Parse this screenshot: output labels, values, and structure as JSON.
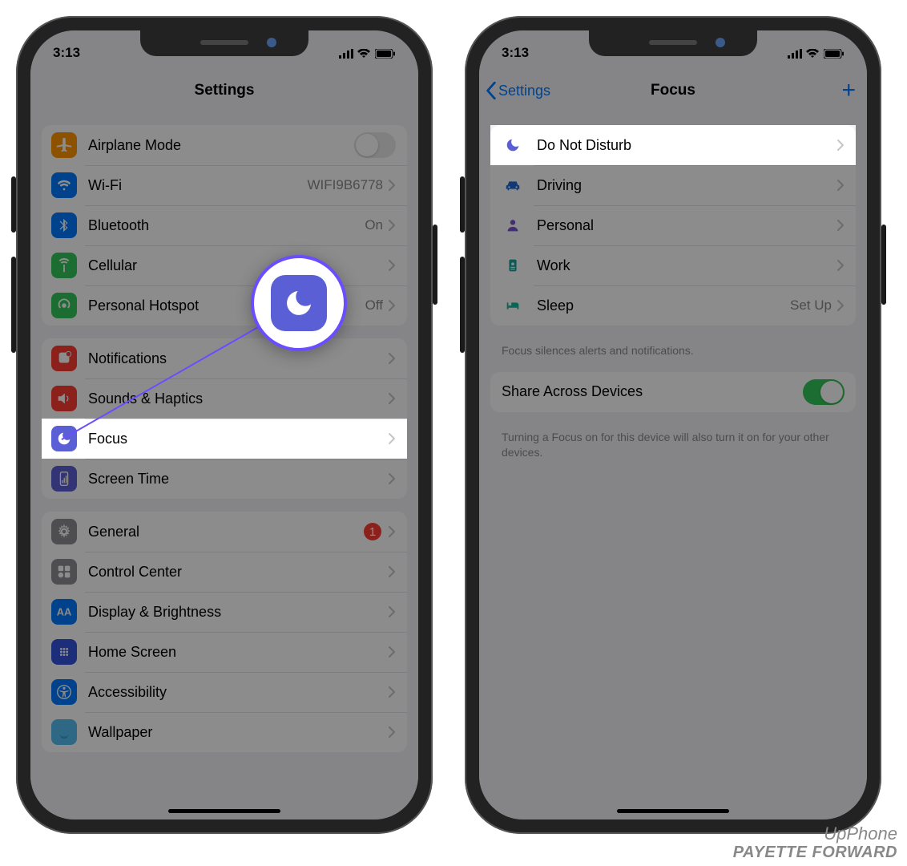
{
  "status": {
    "time": "3:13"
  },
  "left": {
    "title": "Settings",
    "groups": [
      {
        "rows": [
          {
            "icon": "airplane",
            "label": "Airplane Mode",
            "toggle": false
          },
          {
            "icon": "wifi",
            "label": "Wi-Fi",
            "detail": "WIFI9B6778"
          },
          {
            "icon": "bluetooth",
            "label": "Bluetooth",
            "detail": "On"
          },
          {
            "icon": "cellular",
            "label": "Cellular"
          },
          {
            "icon": "hotspot",
            "label": "Personal Hotspot",
            "detail": "Off"
          }
        ]
      },
      {
        "rows": [
          {
            "icon": "notifications",
            "label": "Notifications"
          },
          {
            "icon": "sounds",
            "label": "Sounds & Haptics"
          },
          {
            "icon": "focus",
            "label": "Focus",
            "highlight": true
          },
          {
            "icon": "screentime",
            "label": "Screen Time"
          }
        ]
      },
      {
        "rows": [
          {
            "icon": "general",
            "label": "General",
            "badge": "1"
          },
          {
            "icon": "controlcenter",
            "label": "Control Center"
          },
          {
            "icon": "display",
            "label": "Display & Brightness"
          },
          {
            "icon": "homescreen",
            "label": "Home Screen"
          },
          {
            "icon": "accessibility",
            "label": "Accessibility"
          },
          {
            "icon": "wallpaper",
            "label": "Wallpaper"
          }
        ]
      }
    ]
  },
  "right": {
    "back": "Settings",
    "title": "Focus",
    "modes": [
      {
        "icon": "moon",
        "color": "#5b5fd6",
        "label": "Do Not Disturb",
        "highlight": true
      },
      {
        "icon": "car",
        "color": "#1f6bd6",
        "label": "Driving"
      },
      {
        "icon": "person",
        "color": "#7a52d6",
        "label": "Personal"
      },
      {
        "icon": "badge",
        "color": "#19a59d",
        "label": "Work"
      },
      {
        "icon": "bed",
        "color": "#14b89c",
        "label": "Sleep",
        "detail": "Set Up"
      }
    ],
    "footer1": "Focus silences alerts and notifications.",
    "share": {
      "label": "Share Across Devices",
      "on": true
    },
    "footer2": "Turning a Focus on for this device will also turn it on for your other devices."
  },
  "watermark": {
    "line1": "UpPhone",
    "line2": "PAYETTE FORWARD"
  },
  "icons": {
    "airplane": {
      "bg": "#ff9500"
    },
    "wifi": {
      "bg": "#007aff"
    },
    "bluetooth": {
      "bg": "#007aff"
    },
    "cellular": {
      "bg": "#34c759"
    },
    "hotspot": {
      "bg": "#34c759"
    },
    "notifications": {
      "bg": "#ff3b30"
    },
    "sounds": {
      "bg": "#ff3b30"
    },
    "focus": {
      "bg": "#5b5fd6"
    },
    "screentime": {
      "bg": "#5b5fd6"
    },
    "general": {
      "bg": "#8e8e93"
    },
    "controlcenter": {
      "bg": "#8e8e93"
    },
    "display": {
      "bg": "#007aff"
    },
    "homescreen": {
      "bg": "#3355dd"
    },
    "accessibility": {
      "bg": "#007aff"
    },
    "wallpaper": {
      "bg": "#55bdf0"
    }
  }
}
